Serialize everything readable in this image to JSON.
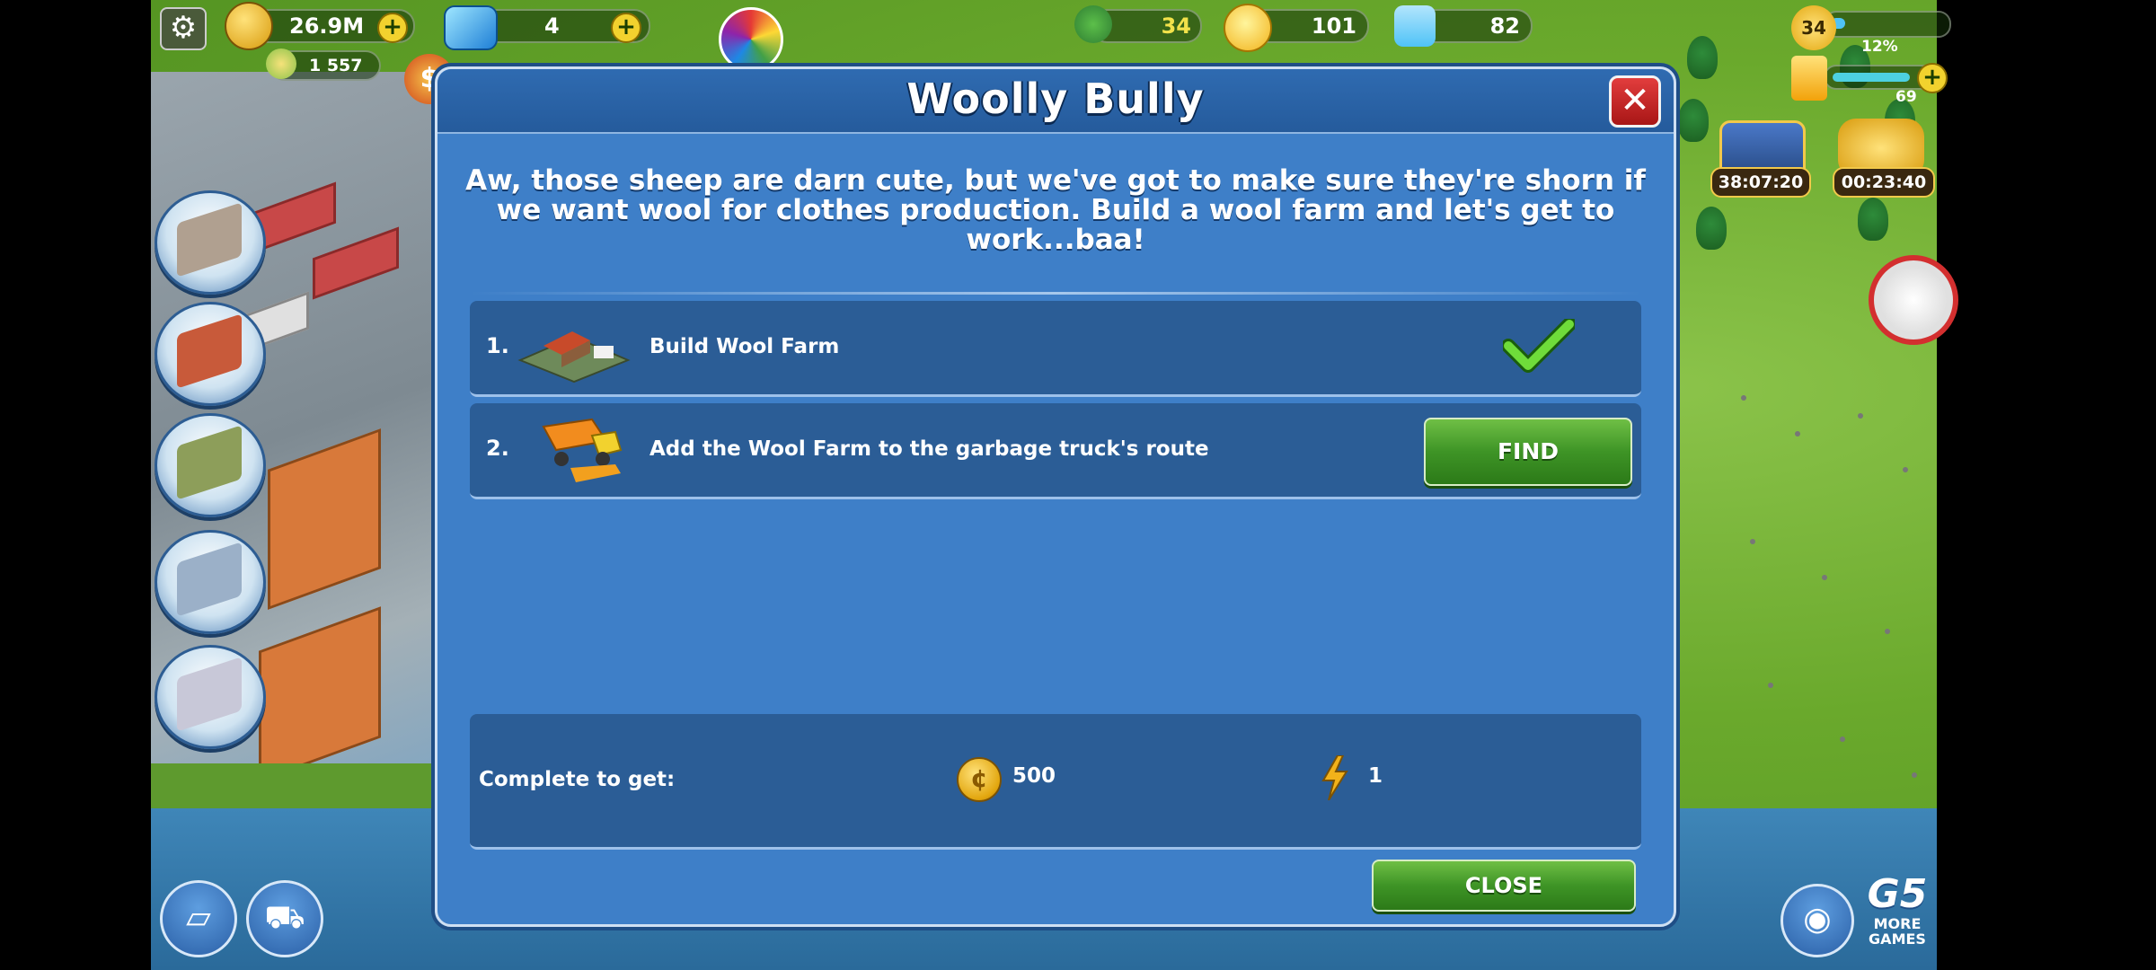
{
  "hud": {
    "coins": "26.9M",
    "cash": "1 557",
    "gems": "4",
    "trees": "34",
    "happiness": "101",
    "population": "82",
    "level": "34",
    "xp_percent": "12%",
    "energy": "69",
    "chest_timer": "38:07:20",
    "gold_timer": "00:23:40"
  },
  "dialog": {
    "title": "Woolly Bully",
    "description": "Aw, those sheep are darn cute, but we've got to make sure they're shorn if we want wool for clothes production. Build a wool farm and let's get to work...baa!",
    "tasks": [
      {
        "num": "1.",
        "label": "Build Wool Farm",
        "status": "done"
      },
      {
        "num": "2.",
        "label": "Add the Wool Farm to the garbage truck's route",
        "button": "FIND"
      }
    ],
    "reward_label": "Complete to get:",
    "reward_coins": "500",
    "reward_energy": "1",
    "close_button": "CLOSE"
  },
  "footer": {
    "brand": "G5",
    "more_games": "MORE GAMES"
  },
  "colors": {
    "dialog_bg": "#3e7fc8",
    "panel_bg": "#2b5d96",
    "button_green": "#3e9426",
    "close_red": "#c42020"
  }
}
